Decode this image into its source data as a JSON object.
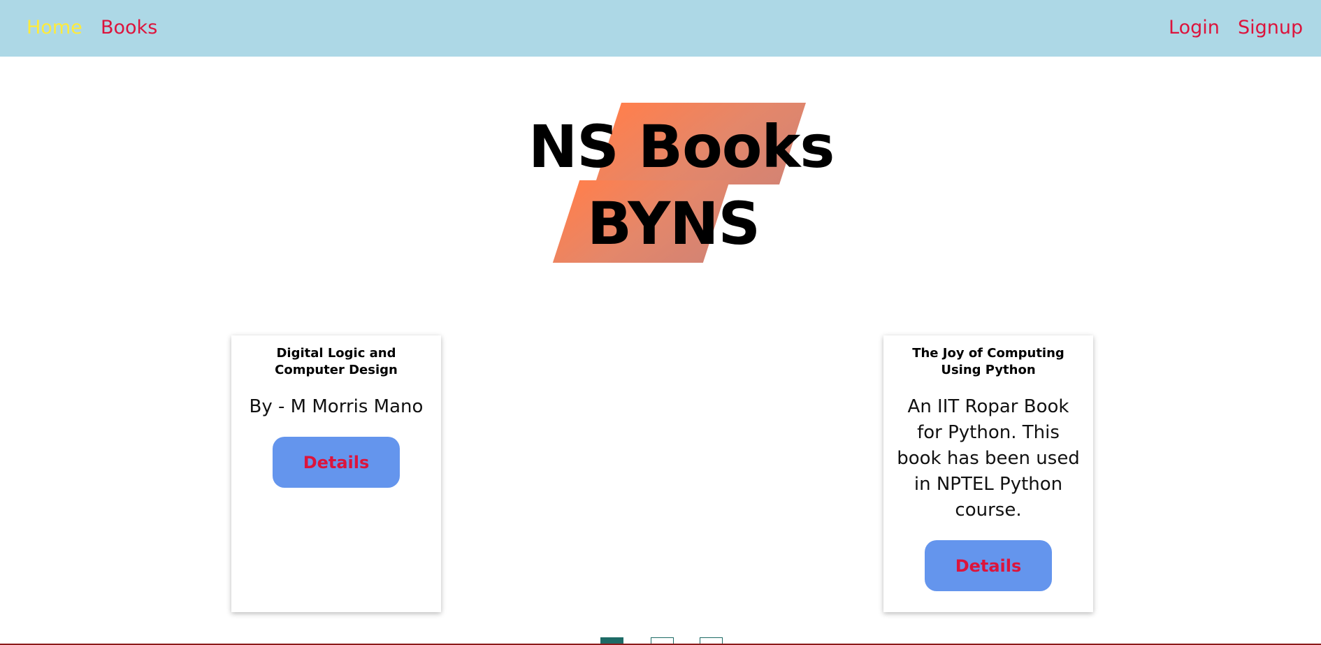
{
  "nav": {
    "left_links": [
      {
        "label": "Home",
        "active": true
      },
      {
        "label": "Books",
        "active": false
      }
    ],
    "right_links": [
      {
        "label": "Login"
      },
      {
        "label": "Signup"
      }
    ],
    "background_color": "#add8e6",
    "link_color": "#dc143c",
    "active_link_color": "#ffeb3b"
  },
  "hero": {
    "line1": "NS Books",
    "line2": "BYNS",
    "accent_color": "#ff7f4d"
  },
  "cards": [
    {
      "title": "Digital Logic and Computer Design",
      "description": "By - M Morris Mano",
      "button_label": "Details"
    },
    {
      "title": "The Joy of Computing Using Python",
      "description": "An IIT Ropar Book for Python. This book has been used in NPTEL Python course.",
      "button_label": "Details"
    }
  ],
  "carousel": {
    "indicator_count": 3,
    "active_index": 0,
    "indicator_color": "#1d6b66"
  },
  "colors": {
    "button_bg": "#6495ed",
    "button_text": "#dc143c"
  }
}
